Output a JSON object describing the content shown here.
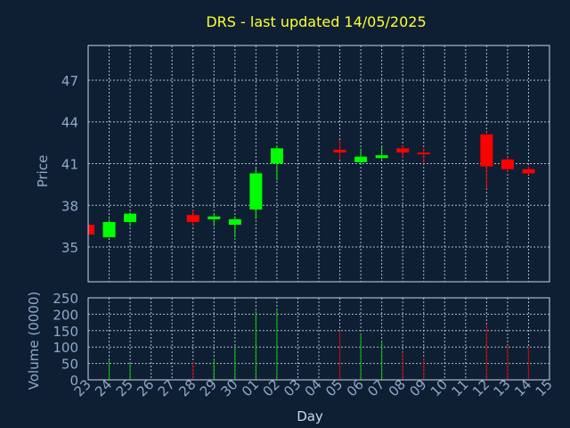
{
  "chart_data": {
    "type": "candlestick",
    "title": "DRS - last updated 14/05/2025",
    "xlabel": "Day",
    "price_ylabel": "Price",
    "volume_ylabel": "Volume (0000)",
    "price_ylim": [
      32.5,
      49.5
    ],
    "price_ticks": [
      35,
      38,
      41,
      44,
      47
    ],
    "volume_ylim": [
      0,
      250
    ],
    "volume_ticks": [
      0,
      50,
      100,
      150,
      200,
      250
    ],
    "grid": true,
    "colors": {
      "up": "#00ff00",
      "down": "#ff0000",
      "volume_up": "#00cc00",
      "volume_down": "#cc0000"
    },
    "x_tick_labels": [
      "23",
      "24",
      "25",
      "26",
      "27",
      "28",
      "29",
      "30",
      "01",
      "02",
      "03",
      "04",
      "05",
      "06",
      "07",
      "08",
      "09",
      "10",
      "11",
      "12",
      "13",
      "14",
      "15"
    ],
    "candles": [
      {
        "day": "23",
        "open": 36.6,
        "high": 36.6,
        "low": 35.9,
        "close": 35.9,
        "volume": 0
      },
      {
        "day": "24",
        "open": 35.7,
        "high": 37.0,
        "low": 35.7,
        "close": 36.8,
        "volume": 60
      },
      {
        "day": "25",
        "open": 36.8,
        "high": 37.5,
        "low": 36.5,
        "close": 37.4,
        "volume": 50
      },
      {
        "day": "28",
        "open": 37.3,
        "high": 37.7,
        "low": 36.5,
        "close": 36.8,
        "volume": 55
      },
      {
        "day": "29",
        "open": 37.0,
        "high": 37.4,
        "low": 36.5,
        "close": 37.2,
        "volume": 65
      },
      {
        "day": "30",
        "open": 36.6,
        "high": 37.2,
        "low": 35.7,
        "close": 37.0,
        "volume": 100
      },
      {
        "day": "01",
        "open": 37.7,
        "high": 40.7,
        "low": 37.0,
        "close": 40.3,
        "volume": 210
      },
      {
        "day": "02",
        "open": 41.0,
        "high": 42.3,
        "low": 39.8,
        "close": 42.1,
        "volume": 215
      },
      {
        "day": "05",
        "open": 42.0,
        "high": 42.7,
        "low": 41.3,
        "close": 41.8,
        "volume": 150
      },
      {
        "day": "06",
        "open": 41.1,
        "high": 42.1,
        "low": 41.0,
        "close": 41.5,
        "volume": 140
      },
      {
        "day": "07",
        "open": 41.4,
        "high": 42.2,
        "low": 41.3,
        "close": 41.6,
        "volume": 120
      },
      {
        "day": "08",
        "open": 42.1,
        "high": 42.3,
        "low": 41.4,
        "close": 41.8,
        "volume": 85
      },
      {
        "day": "09",
        "open": 41.8,
        "high": 42.1,
        "low": 41.0,
        "close": 41.7,
        "volume": 65
      },
      {
        "day": "12",
        "open": 43.1,
        "high": 43.3,
        "low": 39.2,
        "close": 40.8,
        "volume": 170
      },
      {
        "day": "13",
        "open": 41.3,
        "high": 41.5,
        "low": 40.4,
        "close": 40.6,
        "volume": 105
      },
      {
        "day": "14",
        "open": 40.6,
        "high": 40.8,
        "low": 40.2,
        "close": 40.3,
        "volume": 100
      }
    ]
  }
}
